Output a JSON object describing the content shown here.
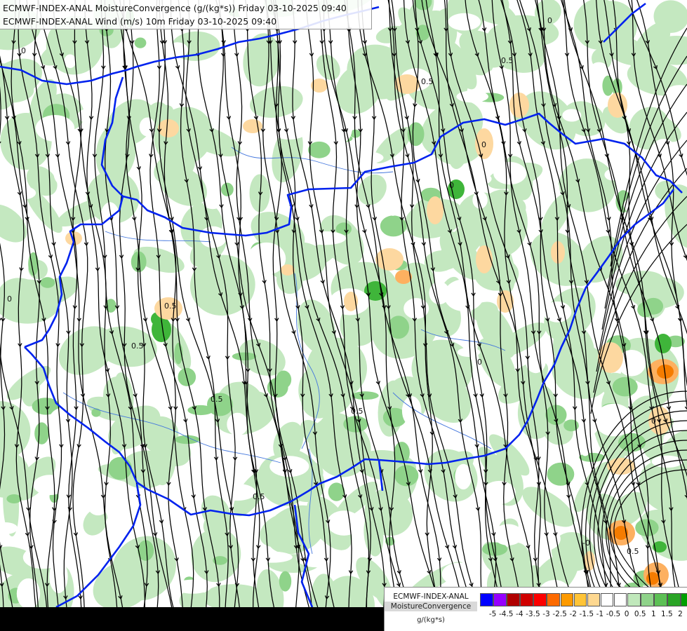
{
  "header": {
    "line1": "ECMWF-INDEX-ANAL MoistureConvergence (g/(kg*s)) Friday 03-10-2025 09:40",
    "line2": "ECMWF-INDEX-ANAL Wind (m/s) 10m Friday 03-10-2025 09:40"
  },
  "legend": {
    "model": "ECMWF-INDEX-ANAL",
    "field": "MoistureConvergence",
    "units": "g/(kg*s)",
    "colors": [
      "#0000ff",
      "#9600fe",
      "#b00000",
      "#d00000",
      "#fd0000",
      "#fd6a00",
      "#fd9a00",
      "#ffc437",
      "#fed890",
      "#ffffff",
      "#ffffff",
      "#c0e8bb",
      "#8fd38a",
      "#5cc055",
      "#2aa526",
      "#00a000"
    ],
    "ticks": [
      "-5",
      "-4.5",
      "-4",
      "-3.5",
      "-3",
      "-2.5",
      "-2",
      "-1.5",
      "-1",
      "-0.5",
      "0",
      "0.5",
      "1",
      "1.5",
      "2"
    ]
  },
  "map": {
    "contour_labels": [
      "0",
      "0",
      "0",
      "0",
      "0",
      "0.5",
      "0.5",
      "0.5",
      "0.5",
      "0.5",
      "0.5",
      "0.5",
      "0",
      "0",
      "0.5",
      "-0"
    ],
    "colors": {
      "border": "#0022ee",
      "river": "#4477dd",
      "stream": "#000000",
      "green_light": "#c4e8c0",
      "green_mid": "#8fd38a",
      "green_dark": "#3fb53a",
      "orange_light": "#fdd8a0",
      "orange_mid": "#fdb060",
      "orange_dark": "#f57c00",
      "bottom_band": "#000000"
    }
  }
}
